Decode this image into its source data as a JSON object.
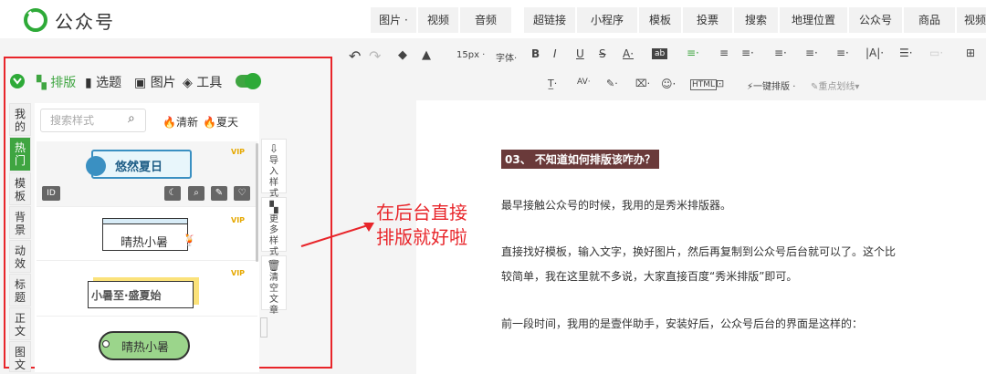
{
  "app": {
    "logo_text": "公众号"
  },
  "menu": {
    "tabs": [
      "图片",
      "视频",
      "音频",
      "超链接",
      "小程序",
      "模板",
      "投票",
      "搜索",
      "地理位置",
      "公众号",
      "商品",
      "视频"
    ]
  },
  "toolbar": {
    "font_size": "15px",
    "font_family": "字体",
    "one_click": "一键排版",
    "highlight": "重点划线",
    "html_label": "HTML"
  },
  "panel": {
    "tabs": [
      "排版",
      "选题",
      "图片",
      "工具"
    ],
    "side_tabs": [
      "我的",
      "热门",
      "模板",
      "背景",
      "动效",
      "标题",
      "正文",
      "图文"
    ],
    "search_placeholder": "搜索样式",
    "hot_tags": [
      "清新",
      "夏天"
    ],
    "items": [
      {
        "title": "悠然夏日",
        "badge": "VIP"
      },
      {
        "title": "晴热小暑",
        "badge": "VIP"
      },
      {
        "title": "小暑至·盛夏始",
        "badge": "VIP"
      },
      {
        "title": "晴热小暑"
      }
    ],
    "id_button": "ID",
    "tools": [
      {
        "label": "导入样式"
      },
      {
        "label": "更多样式"
      },
      {
        "label": "清空文章"
      }
    ]
  },
  "annotation": [
    "在后台直接",
    "排版就好啦"
  ],
  "editor": {
    "heading": "03、 不知道如何排版该咋办？",
    "paragraphs": [
      "最早接触公众号的时候，我用的是秀米排版器。",
      "直接找好模板，输入文字，换好图片，然后再复制到公众号后台就可以了。这个比",
      "较简单，我在这里就不多说，大家直接百度“秀米排版”即可。",
      "前一段时间，我用的是壹伴助手，安装好后，公众号后台的界面是这样的："
    ]
  },
  "colors": {
    "brand_green": "#3fa541",
    "annotation_red": "#e8252a",
    "heading_bg": "#6a3a3a"
  }
}
